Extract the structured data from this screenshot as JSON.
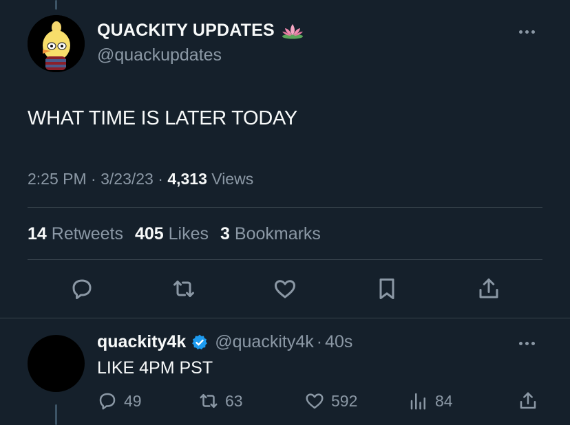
{
  "tweet": {
    "display_name": "QUACKITY UPDATES",
    "handle": "@quackupdates",
    "text": "WHAT TIME IS LATER TODAY",
    "time": "2:25 PM",
    "date": "3/23/23",
    "views_count": "4,313",
    "views_label": "Views",
    "retweets_count": "14",
    "retweets_label": "Retweets",
    "likes_count": "405",
    "likes_label": "Likes",
    "bookmarks_count": "3",
    "bookmarks_label": "Bookmarks",
    "icons": [
      "reply-icon",
      "retweet-icon",
      "like-icon",
      "bookmark-icon",
      "share-icon"
    ]
  },
  "reply": {
    "display_name": "quackity4k",
    "handle": "@quackity4k",
    "time": "40s",
    "text": "LIKE 4PM PST",
    "replies": "49",
    "retweets": "63",
    "likes": "592",
    "views": "84"
  },
  "colors": {
    "background": "#15202b",
    "text": "#f7f9f9",
    "secondary": "#8b98a5",
    "divider": "#38444d",
    "verified": "#1d9bf0"
  }
}
